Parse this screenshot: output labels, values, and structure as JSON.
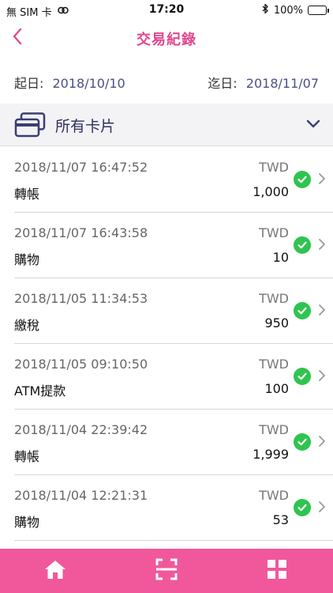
{
  "status_bar": {
    "carrier": "無 SIM 卡",
    "time": "17:20",
    "battery": "100%"
  },
  "nav": {
    "title": "交易紀錄"
  },
  "date_range": {
    "from_label": "起日:",
    "from_value": "2018/10/10",
    "to_label": "迄日:",
    "to_value": "2018/11/07"
  },
  "card_filter": {
    "label": "所有卡片"
  },
  "transactions": [
    {
      "time": "2018/11/07 16:47:52",
      "type": "轉帳",
      "currency": "TWD",
      "amount": "1,000"
    },
    {
      "time": "2018/11/07 16:43:58",
      "type": "購物",
      "currency": "TWD",
      "amount": "10"
    },
    {
      "time": "2018/11/05 11:34:53",
      "type": "繳稅",
      "currency": "TWD",
      "amount": "950"
    },
    {
      "time": "2018/11/05 09:10:50",
      "type": "ATM提款",
      "currency": "TWD",
      "amount": "100"
    },
    {
      "time": "2018/11/04 22:39:42",
      "type": "轉帳",
      "currency": "TWD",
      "amount": "1,999"
    },
    {
      "time": "2018/11/04 12:21:31",
      "type": "購物",
      "currency": "TWD",
      "amount": "53"
    }
  ],
  "colors": {
    "accent": "#e0488f",
    "tabbar": "#f0589b",
    "success": "#2fc44f",
    "date_value": "#4a4f8a"
  },
  "icons": {
    "back": "chevron-left-icon",
    "card": "credit-card-icon",
    "dropdown": "chevron-down-icon",
    "status": "check-circle-icon",
    "detail": "chevron-right-icon",
    "home": "home-icon",
    "scan": "scan-icon",
    "menu": "grid-icon"
  }
}
